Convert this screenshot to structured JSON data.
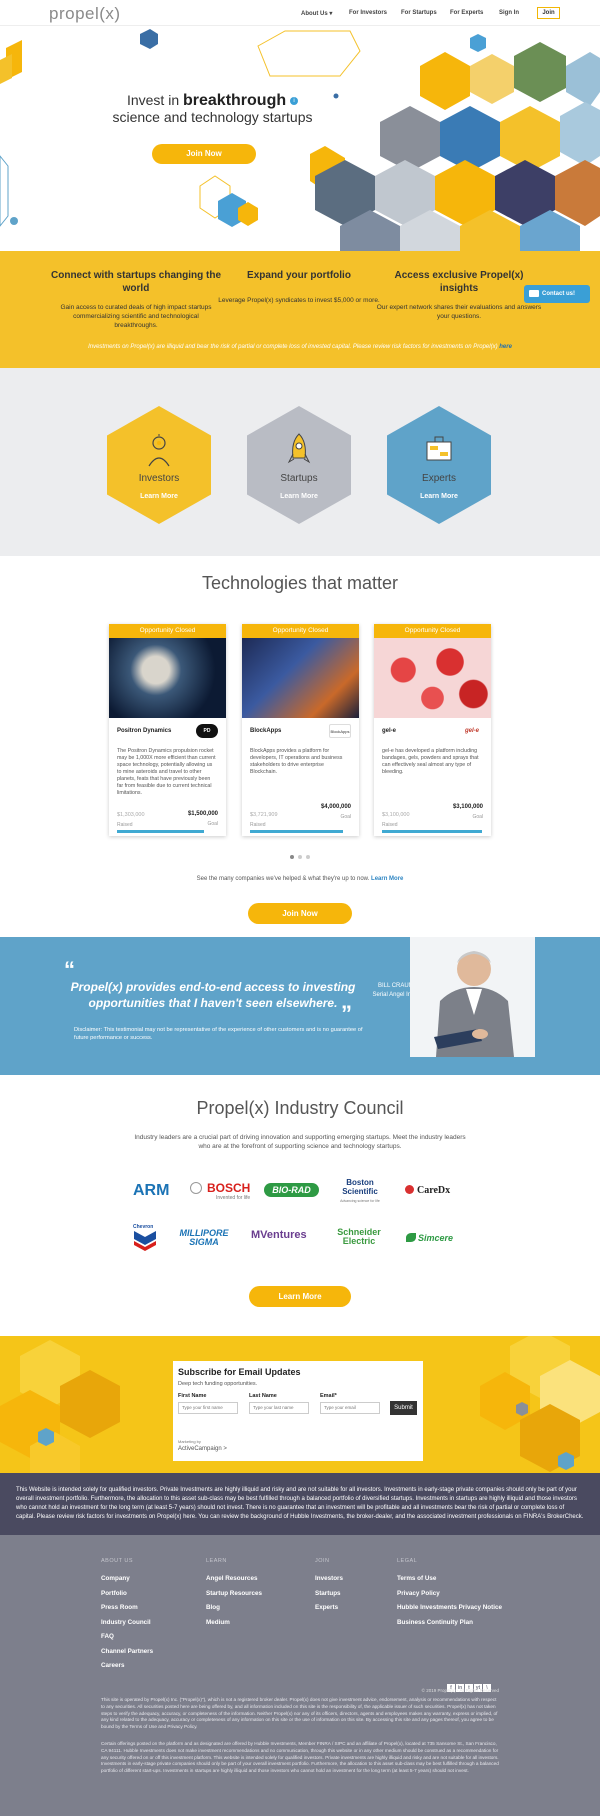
{
  "nav": {
    "logo": "propel(x)",
    "items": [
      "About Us ▾",
      "For Investors",
      "For Startups",
      "For Experts",
      "Sign In"
    ],
    "join": "Join"
  },
  "hero": {
    "line1a": "Invest in ",
    "line1b": "breakthrough",
    "line2": "science and technology startups",
    "join_button": "Join Now"
  },
  "band": {
    "cols": [
      {
        "title": "Connect with startups changing the world",
        "text": "Gain access to curated deals of high impact startups commercializing scientific and technological breakthroughs."
      },
      {
        "title": "Expand your portfolio",
        "text": "Leverage Propel(x) syndicates to invest $5,000 or more."
      },
      {
        "title": "Access exclusive Propel(x) insights",
        "text": "Our expert network shares their evaluations and answers your questions."
      }
    ],
    "disclaimer": "Investments on Propel(x) are illiquid and bear the risk of partial or complete loss of invested capital. Please review risk factors for investments on Propel(x) ",
    "disclaimer_link": "here",
    "contact": "Contact us!"
  },
  "roles": [
    {
      "label": "Investors",
      "cta": "Learn More",
      "color": "#f4c12a"
    },
    {
      "label": "Startups",
      "cta": "Learn More",
      "color": "#b9bcc4"
    },
    {
      "label": "Experts",
      "cta": "Learn More",
      "color": "#5fa3c9"
    }
  ],
  "technologies": {
    "title": "Technologies that matter",
    "cards": [
      {
        "status": "Opportunity Closed",
        "company": "Positron Dynamics",
        "logo": "PD",
        "desc": "The Positron Dynamics propulsion rocket may be 1,000X more efficient than current space technology, potentially allowing us to mine asteroids and travel to other planets, feats that have previously been far from feasible due to current technical limitations.",
        "raised": "$1,303,000",
        "goal": "$1,500,000",
        "raised_label": "Raised",
        "goal_label": "Goal",
        "progress": 0.87
      },
      {
        "status": "Opportunity Closed",
        "company": "BlockApps",
        "logo": "BlockApps",
        "desc": "BlockApps provides a platform for developers, IT operations and business stakeholders to drive enterprise Blockchain.",
        "raised": "$3,721,909",
        "goal": "$4,000,000",
        "raised_label": "Raised",
        "goal_label": "Goal",
        "progress": 0.93
      },
      {
        "status": "Opportunity Closed",
        "company": "gel-e",
        "logo": "gel-e",
        "desc": "gel-e has developed a platform including bandages, gels, powders and sprays that can effectively seal almost any type of bleeding.",
        "raised": "$3,100,000",
        "goal": "$3,100,000",
        "raised_label": "Raised",
        "goal_label": "Goal",
        "progress": 1.0
      }
    ],
    "see_many": "See the many companies we've helped & what they're up to now. ",
    "learn_more": "Learn More",
    "join_button": "Join Now"
  },
  "testimonial": {
    "quote": "Propel(x) provides end-to-end access to investing opportunities that I haven't seen elsewhere.",
    "name": "BILL CRAUMER",
    "role": "Serial Angel Investor",
    "disclaimer": "Disclaimer: This testimonial may not be representative of the experience of other customers and is no guarantee of future performance or success."
  },
  "council": {
    "title": "Propel(x) Industry Council",
    "desc": "Industry leaders are a crucial part of driving innovation and supporting emerging startups. Meet the industry leaders who are at the forefront of supporting science and technology startups.",
    "logos": [
      "ARM",
      "BOSCH",
      "Invented for life",
      "BIO-RAD",
      "Boston Scientific",
      "Advancing science for life",
      "CareDx",
      "Chevron",
      "MILLIPORE SIGMA",
      "MVentures",
      "Schneider Electric",
      "Simcere"
    ],
    "button": "Learn More"
  },
  "subscribe": {
    "title": "Subscribe for Email Updates",
    "desc": "Deep tech funding opportunities.",
    "first": "First Name",
    "last": "Last Name",
    "email": "Email*",
    "first_ph": "Type your first name",
    "last_ph": "Type your last name",
    "email_ph": "Type your email",
    "submit": "Submit",
    "marketing": "Marketing by",
    "provider": "ActiveCampaign >"
  },
  "disclaimer_main": "This Website is intended solely for qualified investors. Private Investments are highly illiquid and risky and are not suitable for all investors. Investments in early-stage private companies should only be part of your overall investment portfolio. Furthermore, the allocation to this asset sub-class may be best fulfilled through a balanced portfolio of diversified startups. Investments in startups are highly illiquid and those investors who cannot hold an investment for the long term (at least 5-7 years) should not invest. There is no guarantee that an investment will be profitable and all investments bear the risk of partial or complete loss of capital. Please review risk factors for investments on Propel(x) here. You can review the background of Hubble Investments, the broker-dealer, and the associated investment professionals on FINRA's BrokerCheck.",
  "footer": {
    "cols": [
      {
        "heading": "ABOUT US",
        "links": [
          "Company",
          "Portfolio",
          "Press Room",
          "Industry Council",
          "FAQ",
          "Channel Partners",
          "Careers"
        ]
      },
      {
        "heading": "LEARN",
        "links": [
          "Angel Resources",
          "Startup Resources",
          "Blog",
          "Medium"
        ]
      },
      {
        "heading": "JOIN",
        "links": [
          "Investors",
          "Startups",
          "Experts"
        ]
      },
      {
        "heading": "LEGAL",
        "links": [
          "Terms of Use",
          "Privacy Policy",
          "Hubble Investments Privacy Notice",
          "Business Continuity Plan"
        ]
      }
    ],
    "social": [
      "f",
      "in",
      "t",
      "yt",
      "\\"
    ],
    "copyright": "© 2019 Propel(x) - All Rights Reserved",
    "text1": "This site is operated by Propel(x) Inc. (\"Propel(x)\"), which is not a registered broker dealer. Propel(x) does not give investment advice, endorsement, analysis or recommendations with respect to any securities. All securities posted here are being offered by, and all information included on this site is the responsibility of, the applicable issuer of such securities. Propel(x) has not taken steps to verify the adequacy, accuracy, or completeness of the information. Neither Propel(x) nor any of its officers, directors, agents and employees makes any warranty, express or implied, of any kind related to the adequacy, accuracy or completeness of any information on this site or the use of information on this site. By accessing this site and any pages thereof, you agree to be bound by the Terms of Use and Privacy Policy.",
    "text2": "Certain offerings posted on the platform and as designated are offered by Hubble Investments, Member FINRA / SIPC and an affiliate of Propel(x), located at 735 Sansome St., San Francisco, CA 94111. Hubble Investments does not make investment recommendations and no communication, through this website or in any other medium should be construed as a recommendation for any security offered on or off this investment platform. This website is intended solely for qualified investors. Private investments are highly illiquid and risky and are not suitable for all investors. Investments in early-stage private companies should only be part of your overall investment portfolio. Furthermore, the allocation to this asset sub-class may be best fulfilled through a balanced portfolio of different start-ups. Investments in startups are highly illiquid and those investors who cannot hold an investment for the long term (at least 5-7 years) should not invest."
  }
}
